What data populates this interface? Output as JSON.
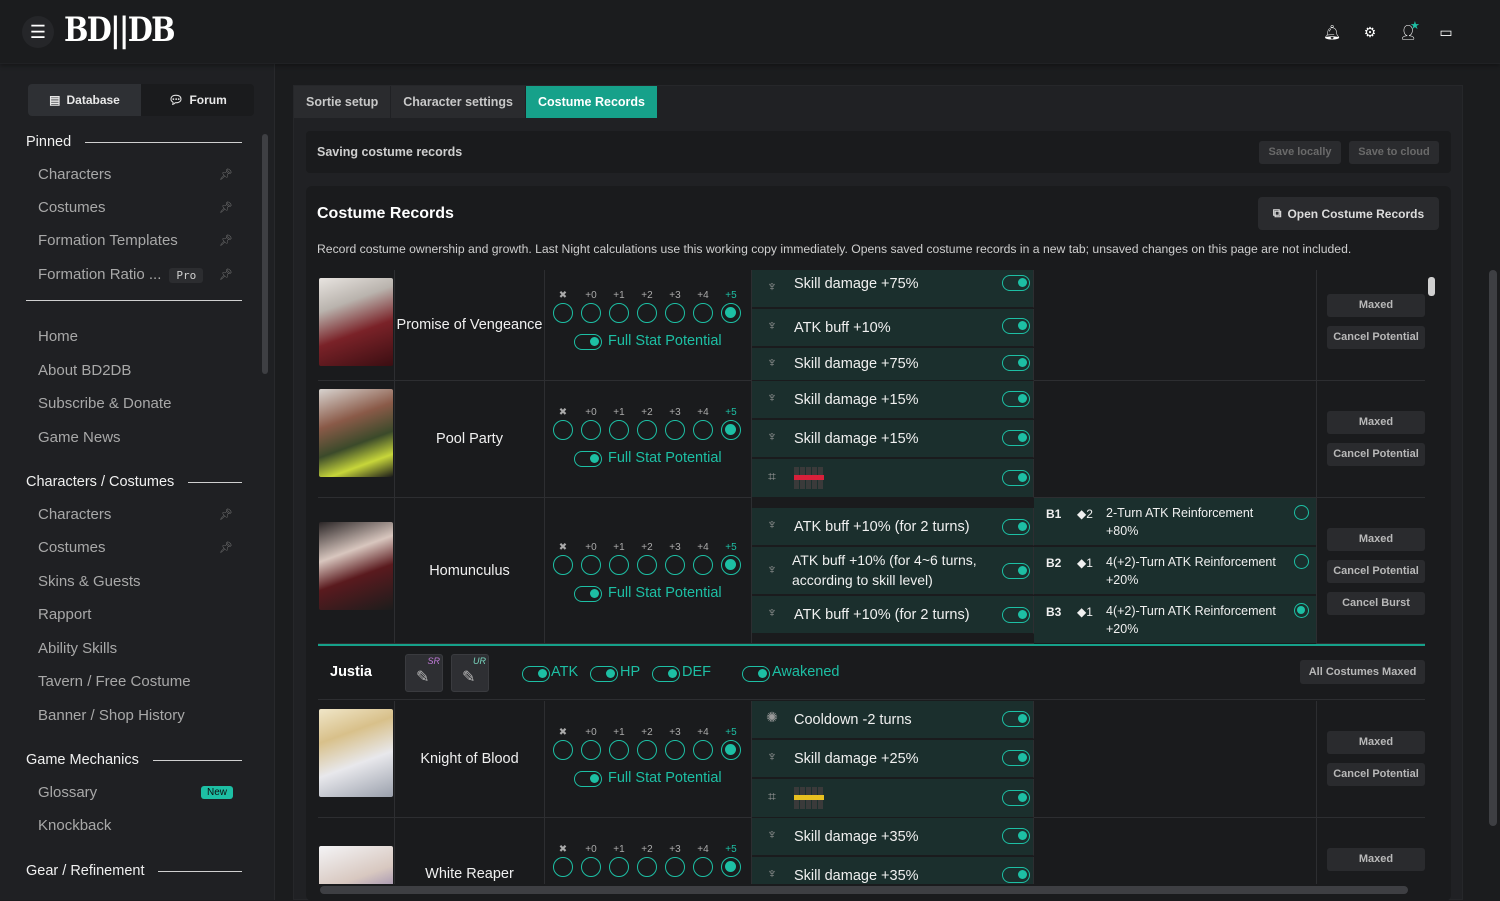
{
  "app": {
    "logo": "BD||DB"
  },
  "topbar_icons": [
    "bell-icon",
    "gear-icon",
    "user-icon",
    "app-icon"
  ],
  "sidebar": {
    "seg": {
      "database": "Database",
      "forum": "Forum"
    },
    "pinned_title": "Pinned",
    "pinned": [
      {
        "label": "Characters"
      },
      {
        "label": "Costumes"
      },
      {
        "label": "Formation Templates"
      },
      {
        "label": "Formation Ratio ...",
        "badge": "Pro"
      }
    ],
    "links": [
      "Home",
      "About BD2DB",
      "Subscribe & Donate",
      "Game News"
    ],
    "chars_title": "Characters / Costumes",
    "chars": [
      "Characters",
      "Costumes",
      "Skins & Guests",
      "Rapport",
      "Ability Skills",
      "Tavern / Free Costume",
      "Banner / Shop History"
    ],
    "mech_title": "Game Mechanics",
    "mech": [
      {
        "label": "Glossary",
        "badge": "New"
      },
      {
        "label": "Knockback"
      }
    ],
    "gear_title": "Gear / Refinement"
  },
  "tabs": [
    "Sortie setup",
    "Character settings",
    "Costume Records"
  ],
  "save": {
    "title": "Saving costume records",
    "local": "Save locally",
    "cloud": "Save to cloud"
  },
  "panel": {
    "title": "Costume Records",
    "open_btn": "Open Costume Records",
    "desc": "Record costume ownership and growth. Last Night calculations use this working copy immediately. Opens saved costume records in a new tab; unsaved changes on this page are not included."
  },
  "potential_labels": [
    "✖",
    "+0",
    "+1",
    "+2",
    "+3",
    "+4",
    "+5"
  ],
  "full_stat": "Full Stat Potential",
  "actions": {
    "maxed": "Maxed",
    "cancel_potential": "Cancel Potential",
    "cancel_burst": "Cancel Burst",
    "all_maxed": "All Costumes Maxed"
  },
  "rows": [
    {
      "name": "Promise of Vengeance",
      "potentials": [
        "Skill damage +75%",
        "ATK buff +10%",
        "Skill damage +75%"
      ]
    },
    {
      "name": "Pool Party",
      "potentials": [
        "Skill damage +15%",
        "Skill damage +15%",
        ""
      ]
    },
    {
      "name": "Homunculus",
      "potentials": [
        "ATK buff +10% (for 2 turns)",
        "ATK buff +10% (for 4~6 turns, according to skill level)",
        "ATK buff +10% (for 2 turns)"
      ],
      "burst": [
        {
          "lvl": "B1",
          "cost": "◆2",
          "text": "2-Turn ATK Reinforcement +80%"
        },
        {
          "lvl": "B2",
          "cost": "◆1",
          "text": "4(+2)-Turn ATK Reinforcement +20%"
        },
        {
          "lvl": "B3",
          "cost": "◆1",
          "text": "4(+2)-Turn ATK Reinforcement +20%"
        }
      ]
    }
  ],
  "group": {
    "name": "Justia",
    "toggles": [
      "ATK",
      "HP",
      "DEF"
    ],
    "awakened": "Awakened",
    "badges": [
      "SR",
      "UR"
    ]
  },
  "rows2": [
    {
      "name": "Knight of Blood",
      "potentials": [
        "Cooldown -2 turns",
        "Skill damage +25%",
        ""
      ]
    },
    {
      "name": "White Reaper",
      "potentials": [
        "Skill damage +35%",
        "Skill damage +35%"
      ]
    }
  ],
  "colors": {
    "accent": "#1dbfa4",
    "bg": "#1b1c1e",
    "cell": "#1b2f2d"
  }
}
